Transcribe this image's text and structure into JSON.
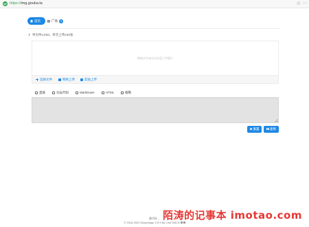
{
  "browser": {
    "url_scheme": "https://",
    "url_host": "img.gouka.la",
    "secure_icon": "shield-check-icon",
    "bookmark_icon": "star-icon",
    "menu_icon": "more-icon",
    "secure_color": "#2ea44f"
  },
  "nav": {
    "home_label": "首页",
    "square_label": "广场",
    "square_badge": "9"
  },
  "upload": {
    "limit_text": "单文件≤10M，单次上传≤30张",
    "drop_hint": "拖拽文件或点击这里上传图片",
    "tools": [
      {
        "label": "选择文件",
        "icon": "plus-icon"
      },
      {
        "label": "网络上传",
        "icon": "cloud-icon"
      },
      {
        "label": "剪贴上传",
        "icon": "clipboard-icon"
      }
    ]
  },
  "result_tabs": [
    {
      "label": "直链",
      "icon": "link-icon"
    },
    {
      "label": "论坛代码",
      "icon": "comment-icon"
    },
    {
      "label": "MarkDown",
      "icon": "code-icon"
    },
    {
      "label": "HTML",
      "icon": "html-icon"
    },
    {
      "label": "缩略",
      "icon": "image-icon"
    }
  ],
  "actions": {
    "reset_label": "重置",
    "copy_label": "复制"
  },
  "footer": {
    "line1": "源代码 ...",
    "line2": "© 2018-2022 EasyImage 2.5.9 By Lost SMCA"
  },
  "watermark": "陌涛的记事本 imotao.com",
  "colors": {
    "accent": "#1e88e5",
    "watermark": "#e53935"
  }
}
